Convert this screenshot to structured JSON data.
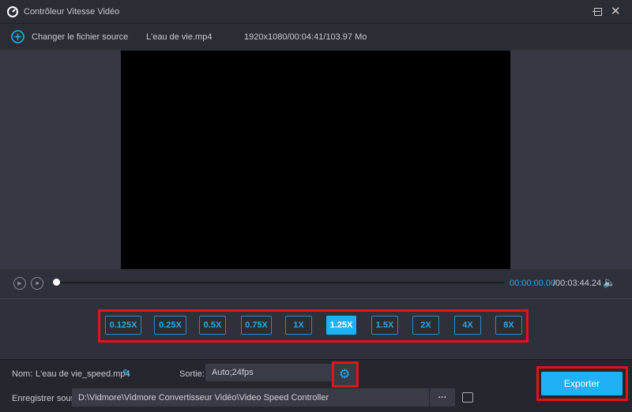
{
  "window": {
    "title": "Contrôleur Vitesse Vidéo"
  },
  "header": {
    "change_source": "Changer le fichier source",
    "file_name": "L'eau de vie.mp4",
    "file_info": "1920x1080/00:04:41/103.97 Mo"
  },
  "player": {
    "current_time": "00:00:00.00",
    "total_time": "/00:03:44.24",
    "progress": 0
  },
  "speeds": [
    "0.125X",
    "0.25X",
    "0.5X",
    "0.75X",
    "1X",
    "1.25X",
    "1.5X",
    "2X",
    "4X",
    "8X"
  ],
  "selected_speed": "1.25X",
  "output": {
    "name_label": "Nom:",
    "name_value": "L'eau de vie_speed.mp4",
    "sortie_label": "Sortie:",
    "sortie_value": "Auto;24fps",
    "save_label": "Enregistrer sous:",
    "save_path": "D:\\Vidmore\\Vidmore Convertisseur Vidéo\\Video Speed Controller",
    "browse": "···",
    "export": "Exporter"
  },
  "colors": {
    "accent": "#1fb1f5",
    "highlight": "#e0141e"
  }
}
